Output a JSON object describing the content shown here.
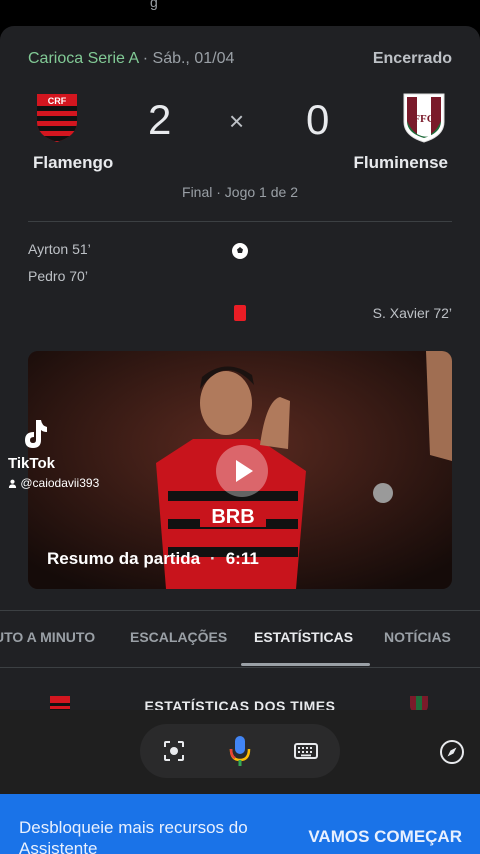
{
  "top_hint": "g",
  "match": {
    "league": "Carioca Serie A",
    "date": "Sáb., 01/04",
    "status": "Encerrado",
    "home": {
      "name": "Flamengo",
      "score": "2"
    },
    "away": {
      "name": "Fluminense",
      "score": "0"
    },
    "vs_symbol": "×",
    "final_line": "Final · Jogo 1 de 2"
  },
  "events": {
    "home_goals": [
      "Ayrton 51’",
      "Pedro 70’"
    ],
    "away_red_cards": [
      "S. Xavier 72’"
    ]
  },
  "video": {
    "title": "Resumo da partida",
    "separator": "·",
    "duration": "6:11"
  },
  "tiktok": {
    "label": "TikTok",
    "handle": "@caiodavii393"
  },
  "tabs": [
    {
      "label": "UTO A MINUTO",
      "active": false
    },
    {
      "label": "ESCALAÇÕES",
      "active": false
    },
    {
      "label": "ESTATÍSTICAS",
      "active": true
    },
    {
      "label": "NOTÍCIAS",
      "active": false
    }
  ],
  "stats": {
    "title": "ESTATÍSTICAS DOS TIMES"
  },
  "assistant": {
    "icons": [
      "lens-icon",
      "mic-icon",
      "keyboard-icon",
      "compass-icon"
    ]
  },
  "banner": {
    "message": "Desbloqueie mais recursos do Assistente",
    "cta": "VAMOS COMEÇAR"
  },
  "colors": {
    "card_bg": "#202124",
    "league_green": "#81c995",
    "banner_blue": "#1a73e8",
    "flamengo_red": "#d3161f",
    "fluminense_green": "#1e6b3a",
    "fluminense_maroon": "#7a1a2a"
  }
}
